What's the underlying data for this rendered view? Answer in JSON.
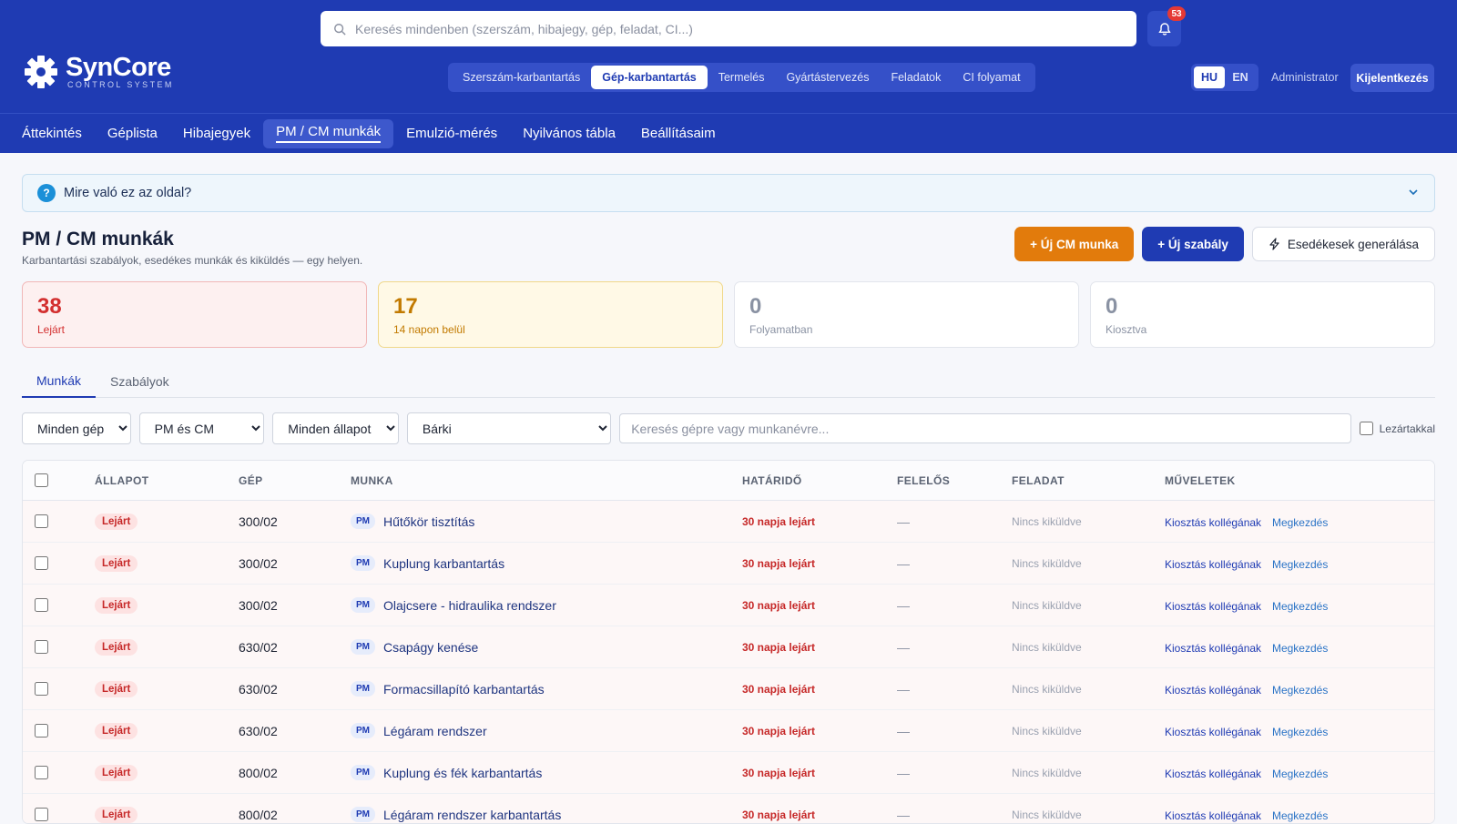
{
  "search": {
    "placeholder": "Keresés mindenben (szerszám, hibajegy, gép, feladat, CI...)"
  },
  "notifications": {
    "count": "53"
  },
  "logo": {
    "name": "SynCore",
    "subtitle": "CONTROL SYSTEM"
  },
  "modules": [
    {
      "label": "Szerszám-karbantartás",
      "active": false
    },
    {
      "label": "Gép-karbantartás",
      "active": true
    },
    {
      "label": "Termelés",
      "active": false
    },
    {
      "label": "Gyártástervezés",
      "active": false
    },
    {
      "label": "Feladatok",
      "active": false
    },
    {
      "label": "CI folyamat",
      "active": false
    }
  ],
  "lang": {
    "hu": "HU",
    "en": "EN",
    "active": "HU"
  },
  "user": {
    "name": "Administrator",
    "logout_label": "Kijelentkezés"
  },
  "subnav": [
    {
      "label": "Áttekintés",
      "active": false
    },
    {
      "label": "Géplista",
      "active": false
    },
    {
      "label": "Hibajegyek",
      "active": false
    },
    {
      "label": "PM / CM munkák",
      "active": true
    },
    {
      "label": "Emulzió-mérés",
      "active": false
    },
    {
      "label": "Nyilvános tábla",
      "active": false
    },
    {
      "label": "Beállításaim",
      "active": false
    }
  ],
  "help": {
    "title": "Mire való ez az oldal?"
  },
  "page": {
    "title": "PM / CM munkák",
    "subtitle": "Karbantartási szabályok, esedékes munkák és kiküldés — egy helyen."
  },
  "actions": {
    "new_cm": "+ Új CM munka",
    "new_rule": "+ Új szabály",
    "generate": "Esedékesek generálása"
  },
  "stats": [
    {
      "value": "38",
      "label": "Lejárt",
      "tone": "red"
    },
    {
      "value": "17",
      "label": "14 napon belül",
      "tone": "yellow"
    },
    {
      "value": "0",
      "label": "Folyamatban",
      "tone": "grey"
    },
    {
      "value": "0",
      "label": "Kiosztva",
      "tone": "grey"
    }
  ],
  "tabs": [
    {
      "label": "Munkák",
      "active": true
    },
    {
      "label": "Szabályok",
      "active": false
    }
  ],
  "filters": {
    "machine": "Minden gép",
    "type": "PM és CM",
    "status": "Minden állapot",
    "owner": "Bárki",
    "search_placeholder": "Keresés gépre vagy munkanévre...",
    "closed_label": "Lezártakkal"
  },
  "table": {
    "headers": {
      "state": "ÁLLAPOT",
      "machine": "GÉP",
      "job": "MUNKA",
      "due": "HATÁRIDŐ",
      "owner": "FELELŐS",
      "task": "FELADAT",
      "actions": "MŰVELETEK"
    },
    "action_assign": "Kiosztás kollégának",
    "action_start": "Megkezdés",
    "rows": [
      {
        "state": "Lejárt",
        "machine": "300/02",
        "type": "PM",
        "job": "Hűtőkör tisztítás",
        "due": "30 napja lejárt",
        "owner": "—",
        "task": "Nincs kiküldve"
      },
      {
        "state": "Lejárt",
        "machine": "300/02",
        "type": "PM",
        "job": "Kuplung karbantartás",
        "due": "30 napja lejárt",
        "owner": "—",
        "task": "Nincs kiküldve"
      },
      {
        "state": "Lejárt",
        "machine": "300/02",
        "type": "PM",
        "job": "Olajcsere - hidraulika rendszer",
        "due": "30 napja lejárt",
        "owner": "—",
        "task": "Nincs kiküldve"
      },
      {
        "state": "Lejárt",
        "machine": "630/02",
        "type": "PM",
        "job": "Csapágy kenése",
        "due": "30 napja lejárt",
        "owner": "—",
        "task": "Nincs kiküldve"
      },
      {
        "state": "Lejárt",
        "machine": "630/02",
        "type": "PM",
        "job": "Formacsillapító karbantartás",
        "due": "30 napja lejárt",
        "owner": "—",
        "task": "Nincs kiküldve"
      },
      {
        "state": "Lejárt",
        "machine": "630/02",
        "type": "PM",
        "job": "Légáram rendszer",
        "due": "30 napja lejárt",
        "owner": "—",
        "task": "Nincs kiküldve"
      },
      {
        "state": "Lejárt",
        "machine": "800/02",
        "type": "PM",
        "job": "Kuplung és fék karbantartás",
        "due": "30 napja lejárt",
        "owner": "—",
        "task": "Nincs kiküldve"
      },
      {
        "state": "Lejárt",
        "machine": "800/02",
        "type": "PM",
        "job": "Légáram rendszer karbantartás",
        "due": "30 napja lejárt",
        "owner": "—",
        "task": "Nincs kiküldve"
      }
    ]
  }
}
